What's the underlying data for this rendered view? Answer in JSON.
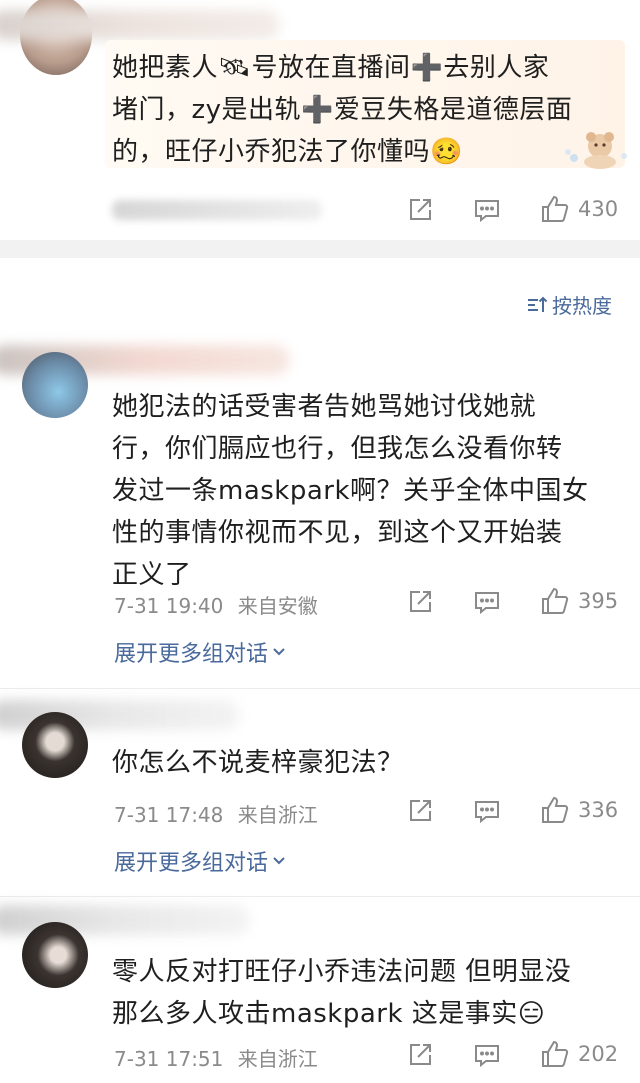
{
  "sort": {
    "label": "按热度"
  },
  "top_comment": {
    "lines": [
      "她把素人🛰号放在直播间➕去别人家",
      "堵门，zy是出轨➕爱豆失格是道德层面",
      "的，旺仔小乔犯法了你懂吗🥴"
    ],
    "likes": "430"
  },
  "comments": [
    {
      "lines": [
        "她犯法的话受害者告她骂她讨伐她就",
        "行，你们膈应也行，但我怎么没看你转",
        "发过一条maskpark啊？关乎全体中国女",
        "性的事情你视而不见，到这个又开始装",
        "正义了"
      ],
      "time": "7-31 19:40",
      "location": "来自安徽",
      "likes": "395",
      "expand": "展开更多组对话"
    },
    {
      "lines": [
        "你怎么不说麦梓豪犯法？"
      ],
      "time": "7-31 17:48",
      "location": "来自浙江",
      "likes": "336",
      "expand": "展开更多组对话"
    },
    {
      "lines": [
        "零人反对打旺仔小乔违法问题 但明显没",
        "那么多人攻击maskpark 这是事实😑"
      ],
      "time": "7-31 17:51",
      "location": "来自浙江",
      "likes": "202"
    }
  ],
  "colors": {
    "link": "#4a6a9c",
    "meta": "#8a8a8a",
    "section_gap": "#f2f2f2"
  }
}
